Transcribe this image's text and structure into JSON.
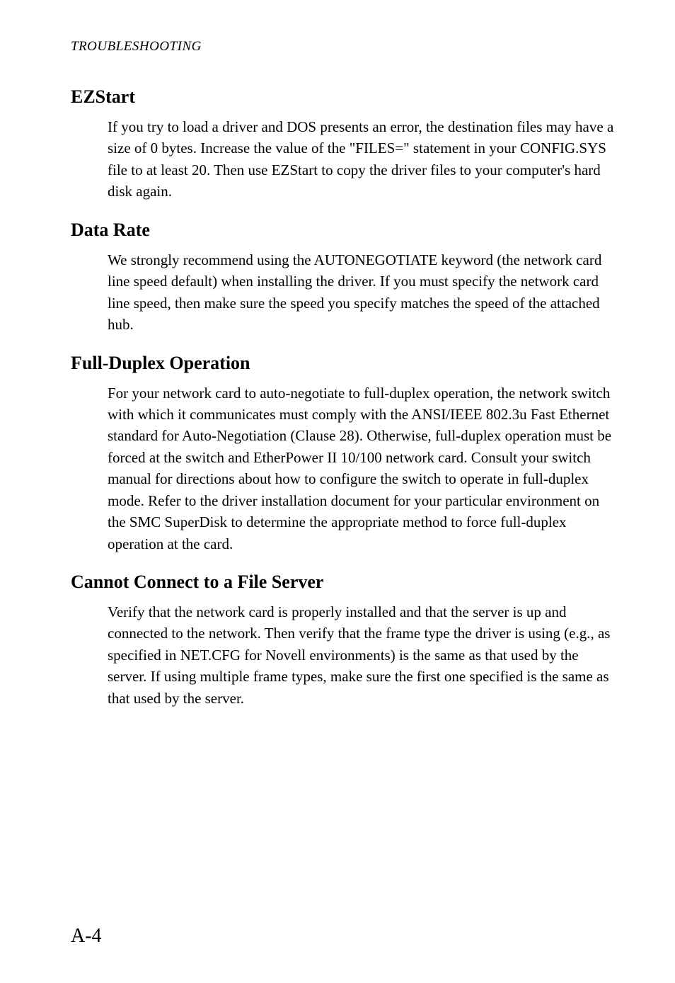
{
  "running_header": "TROUBLESHOOTING",
  "sections": [
    {
      "heading": "EZStart",
      "body": "If you try to load a driver and DOS presents an error, the destination files may have a size of 0 bytes. Increase the value of the \"FILES=\" statement in your CONFIG.SYS file to at least 20. Then use EZStart to copy the driver files to your computer's hard disk again."
    },
    {
      "heading": "Data Rate",
      "body": "We strongly recommend using the AUTONEGOTIATE keyword (the network card line speed default) when installing the driver. If you must specify the network card line speed, then make sure the speed you specify matches the speed of the attached hub."
    },
    {
      "heading": "Full-Duplex Operation",
      "body": "For your network card to auto-negotiate to full-duplex operation, the network switch with which it communicates must comply with the ANSI/IEEE 802.3u Fast Ethernet standard for Auto-Negotiation (Clause 28). Otherwise, full-duplex operation must be forced at the switch and EtherPower II 10/100 network card. Consult your switch manual for directions about how to configure the switch to operate in full-duplex mode. Refer to the driver installation document for your particular environment on the SMC SuperDisk to determine the appropriate method to force full-duplex operation at the card."
    },
    {
      "heading": "Cannot Connect to a File Server",
      "body": "Verify that the network card is properly installed and that the server is up and connected to the network. Then verify that the frame type the driver is using (e.g., as specified in NET.CFG for Novell environments) is the same as that used by the server. If using multiple frame types, make sure the first one specified is the same as that used by the server."
    }
  ],
  "page_number": "A-4"
}
